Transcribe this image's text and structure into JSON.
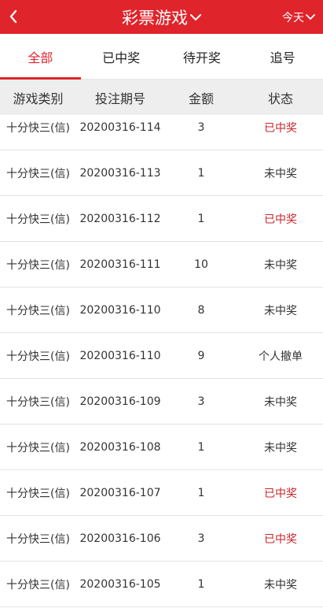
{
  "header": {
    "title": "彩票游戏",
    "range_label": "今天",
    "bg_color": "#e0242b"
  },
  "tabs": [
    {
      "label": "全部",
      "active": true
    },
    {
      "label": "已中奖",
      "active": false
    },
    {
      "label": "待开奖",
      "active": false
    },
    {
      "label": "追号",
      "active": false
    }
  ],
  "table": {
    "columns": [
      "游戏类别",
      "投注期号",
      "金额",
      "状态"
    ],
    "rows": [
      {
        "game": "十分快三(信)",
        "period": "20200316-114",
        "amount": "3",
        "status": "已中奖",
        "won": true
      },
      {
        "game": "十分快三(信)",
        "period": "20200316-113",
        "amount": "1",
        "status": "未中奖",
        "won": false
      },
      {
        "game": "十分快三(信)",
        "period": "20200316-112",
        "amount": "1",
        "status": "已中奖",
        "won": true
      },
      {
        "game": "十分快三(信)",
        "period": "20200316-111",
        "amount": "10",
        "status": "未中奖",
        "won": false
      },
      {
        "game": "十分快三(信)",
        "period": "20200316-110",
        "amount": "8",
        "status": "未中奖",
        "won": false
      },
      {
        "game": "十分快三(信)",
        "period": "20200316-110",
        "amount": "9",
        "status": "个人撤单",
        "won": false
      },
      {
        "game": "十分快三(信)",
        "period": "20200316-109",
        "amount": "3",
        "status": "未中奖",
        "won": false
      },
      {
        "game": "十分快三(信)",
        "period": "20200316-108",
        "amount": "1",
        "status": "未中奖",
        "won": false
      },
      {
        "game": "十分快三(信)",
        "period": "20200316-107",
        "amount": "1",
        "status": "已中奖",
        "won": true
      },
      {
        "game": "十分快三(信)",
        "period": "20200316-106",
        "amount": "3",
        "status": "已中奖",
        "won": true
      },
      {
        "game": "十分快三(信)",
        "period": "20200316-105",
        "amount": "1",
        "status": "未中奖",
        "won": false
      }
    ]
  }
}
